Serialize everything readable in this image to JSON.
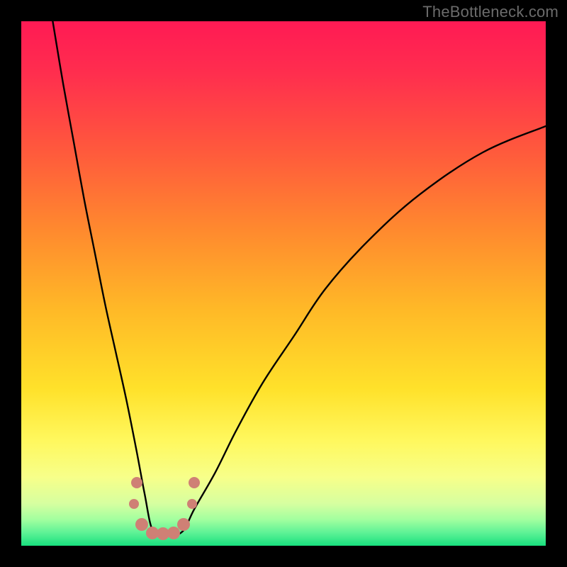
{
  "watermark": "TheBottleneck.com",
  "chart_data": {
    "type": "line",
    "title": "",
    "xlabel": "",
    "ylabel": "",
    "xlim": [
      0,
      100
    ],
    "ylim": [
      0,
      100
    ],
    "grid": false,
    "legend": false,
    "series": [
      {
        "name": "curve",
        "x": [
          6,
          8,
          10,
          12,
          14,
          16,
          18,
          20,
          22,
          23.5,
          25,
          27,
          29,
          31,
          33,
          37,
          41,
          46,
          52,
          58,
          66,
          76,
          88,
          100
        ],
        "y": [
          100,
          88,
          77,
          66,
          56,
          46,
          37,
          28,
          18,
          10,
          3,
          2,
          2,
          3,
          7,
          14,
          22,
          31,
          40,
          49,
          58,
          67,
          75,
          80
        ]
      }
    ],
    "gradient_stops": [
      {
        "offset": 0.0,
        "color": "#ff1a54"
      },
      {
        "offset": 0.1,
        "color": "#ff2e4e"
      },
      {
        "offset": 0.25,
        "color": "#ff5a3c"
      },
      {
        "offset": 0.4,
        "color": "#ff8a2e"
      },
      {
        "offset": 0.55,
        "color": "#ffb927"
      },
      {
        "offset": 0.7,
        "color": "#ffe12a"
      },
      {
        "offset": 0.8,
        "color": "#fff85e"
      },
      {
        "offset": 0.87,
        "color": "#f7ff8a"
      },
      {
        "offset": 0.92,
        "color": "#d6ffa0"
      },
      {
        "offset": 0.95,
        "color": "#a2ff9f"
      },
      {
        "offset": 0.975,
        "color": "#5ef296"
      },
      {
        "offset": 1.0,
        "color": "#18e07e"
      }
    ],
    "markers": [
      {
        "x": 22.0,
        "y": 12,
        "r": 8
      },
      {
        "x": 21.5,
        "y": 8,
        "r": 7
      },
      {
        "x": 23.0,
        "y": 4,
        "r": 9
      },
      {
        "x": 25.0,
        "y": 2.5,
        "r": 9
      },
      {
        "x": 27.0,
        "y": 2.3,
        "r": 9
      },
      {
        "x": 29.0,
        "y": 2.5,
        "r": 9
      },
      {
        "x": 31.0,
        "y": 4,
        "r": 9
      },
      {
        "x": 32.5,
        "y": 8,
        "r": 7
      },
      {
        "x": 33.0,
        "y": 12,
        "r": 8
      }
    ]
  }
}
